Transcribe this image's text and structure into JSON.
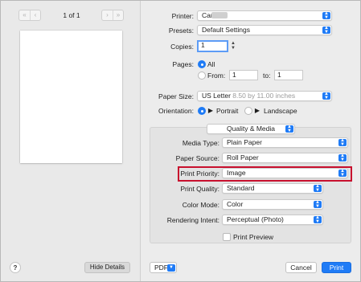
{
  "preview": {
    "page_indicator": "1 of 1",
    "help_label": "?",
    "hide_details_label": "Hide Details"
  },
  "printer": {
    "label": "Printer:",
    "value": "Canon"
  },
  "presets": {
    "label": "Presets:",
    "value": "Default Settings"
  },
  "copies": {
    "label": "Copies:",
    "value": "1"
  },
  "pages": {
    "label": "Pages:",
    "all_label": "All",
    "from_label": "From:",
    "from_value": "1",
    "to_label": "to:",
    "to_value": "1",
    "selected": "All"
  },
  "paper_size": {
    "label": "Paper Size:",
    "value": "US Letter",
    "detail": "8.50 by 11.00 inches"
  },
  "orientation": {
    "label": "Orientation:",
    "portrait_label": "Portrait",
    "landscape_label": "Landscape",
    "selected": "Portrait"
  },
  "section_popup": {
    "value": "Quality & Media"
  },
  "media_type": {
    "label": "Media Type:",
    "value": "Plain Paper"
  },
  "paper_source": {
    "label": "Paper Source:",
    "value": "Roll Paper"
  },
  "print_priority": {
    "label": "Print Priority:",
    "value": "Image"
  },
  "print_quality": {
    "label": "Print Quality:",
    "value": "Standard"
  },
  "color_mode": {
    "label": "Color Mode:",
    "value": "Color"
  },
  "rendering_intent": {
    "label": "Rendering Intent:",
    "value": "Perceptual (Photo)"
  },
  "print_preview": {
    "label": "Print Preview",
    "checked": false
  },
  "footer": {
    "pdf_label": "PDF",
    "cancel_label": "Cancel",
    "print_label": "Print"
  },
  "colors": {
    "accent": "#1f7bf6",
    "highlight_border": "#c8102e",
    "window_bg": "#ececec"
  }
}
